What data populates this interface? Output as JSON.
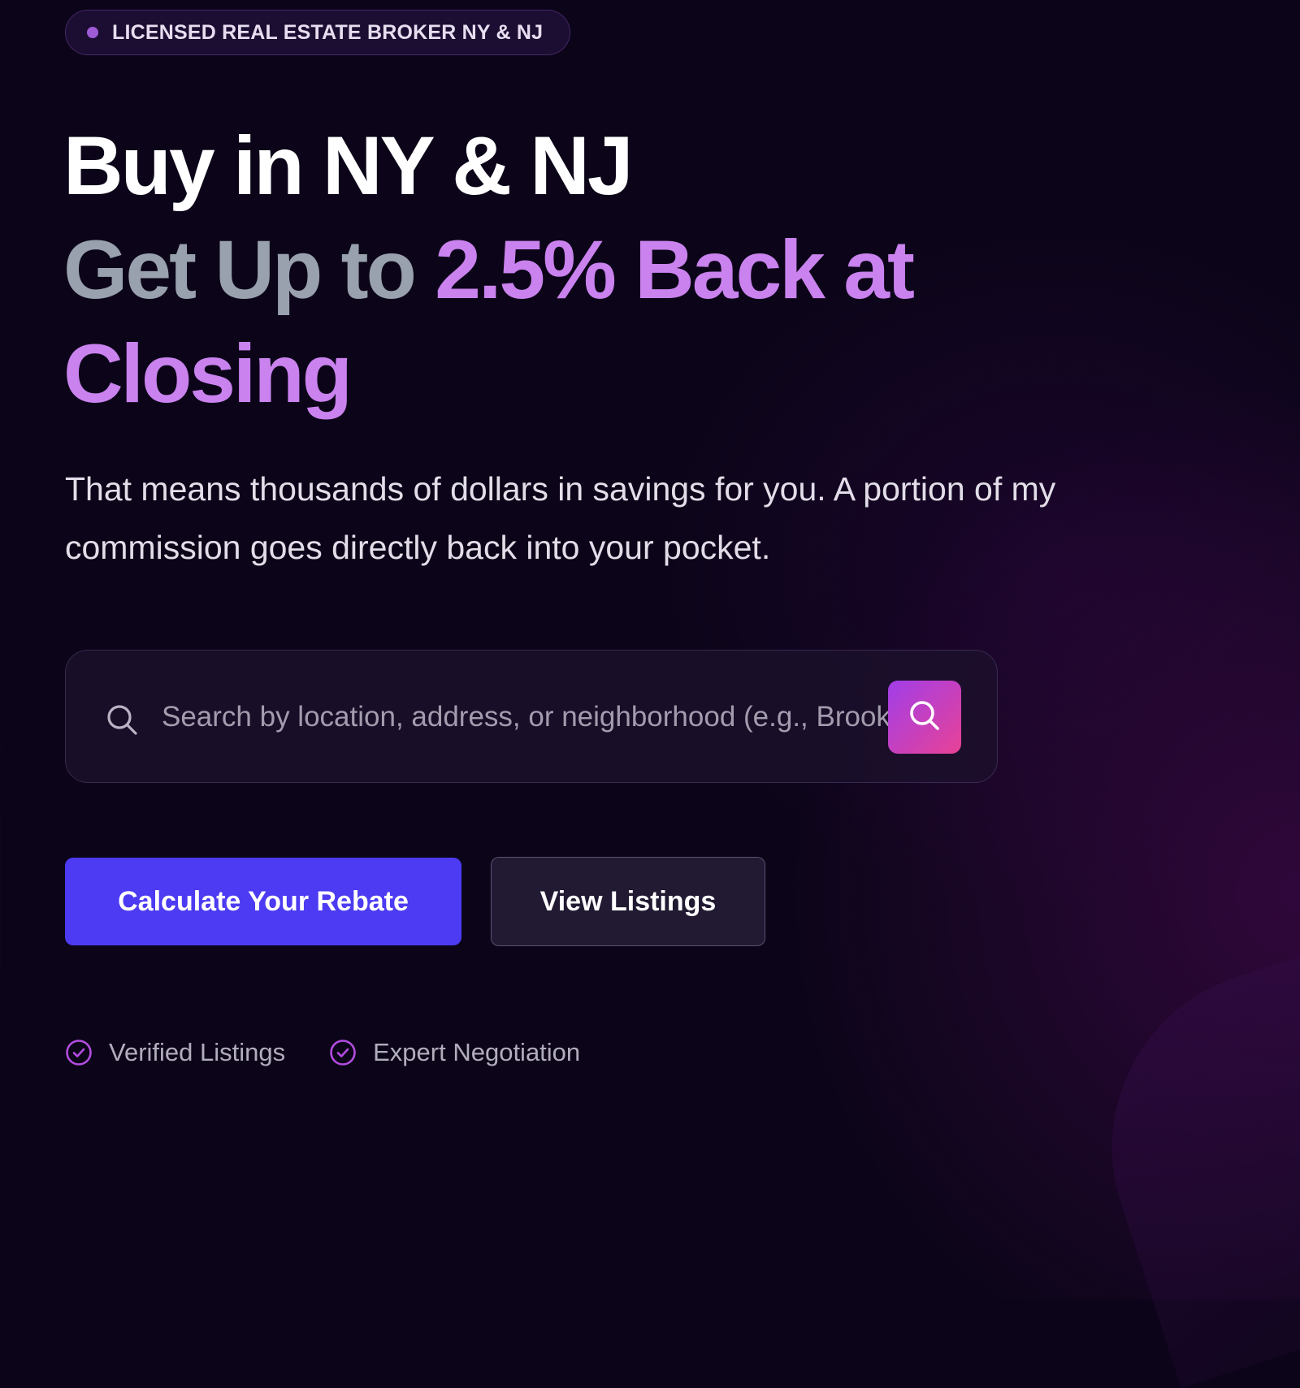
{
  "badge": {
    "text": "LICENSED REAL ESTATE BROKER NY & NJ"
  },
  "headline": {
    "line1": "Buy in NY & NJ",
    "line2_prefix": "Get Up to ",
    "line2_highlight": "2.5% Back at",
    "line3_highlight": "Closing"
  },
  "subtext": "That means thousands of dollars in savings for you. A portion of my commission goes directly back into your pocket.",
  "search": {
    "placeholder": "Search by location, address, or neighborhood (e.g., Brooklyn)",
    "value": "",
    "icon_left": "search-icon",
    "submit_icon": "search-icon"
  },
  "buttons": {
    "primary_label": "Calculate Your Rebate",
    "secondary_label": "View Listings"
  },
  "features": [
    {
      "label": "Verified Listings",
      "icon": "check-circle-icon"
    },
    {
      "label": "Expert Negotiation",
      "icon": "check-circle-icon"
    }
  ],
  "colors": {
    "background": "#0c0519",
    "accent_purple": "#c982ee",
    "headline_gray": "#98a1ad",
    "primary_button": "#4c3bf2",
    "search_button_gradient_start": "#a13ee8",
    "search_button_gradient_end": "#e84296",
    "feature_icon": "#b34ce0"
  }
}
